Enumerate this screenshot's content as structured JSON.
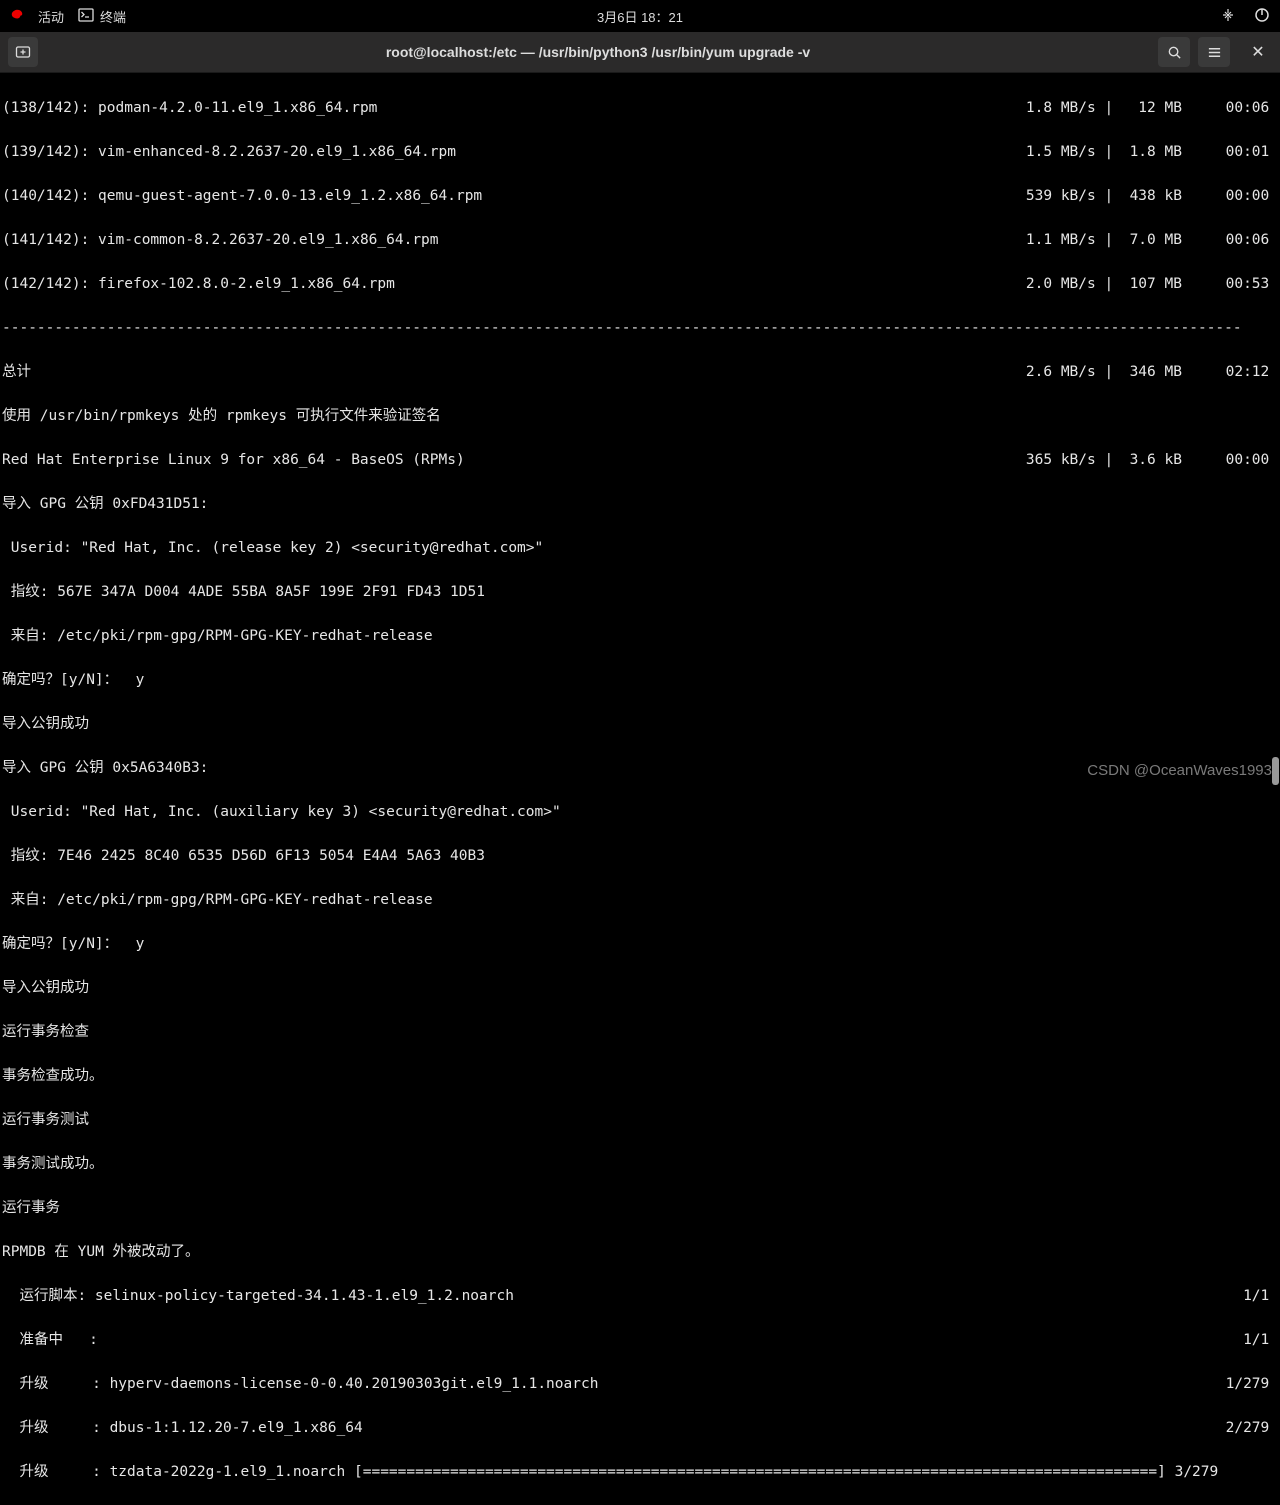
{
  "topbar": {
    "activities": "活动",
    "app": "终端",
    "clock": "3月6日 18：21"
  },
  "window": {
    "title": "root@localhost:/etc — /usr/bin/python3 /usr/bin/yum upgrade -v"
  },
  "downloads": [
    {
      "idx": "(138/142):",
      "name": "podman-4.2.0-11.el9_1.x86_64.rpm",
      "speed": "1.8 MB/s",
      "size": "12 MB",
      "time": "00:06"
    },
    {
      "idx": "(139/142):",
      "name": "vim-enhanced-8.2.2637-20.el9_1.x86_64.rpm",
      "speed": "1.5 MB/s",
      "size": "1.8 MB",
      "time": "00:01"
    },
    {
      "idx": "(140/142):",
      "name": "qemu-guest-agent-7.0.0-13.el9_1.2.x86_64.rpm",
      "speed": "539 kB/s",
      "size": "438 kB",
      "time": "00:00"
    },
    {
      "idx": "(141/142):",
      "name": "vim-common-8.2.2637-20.el9_1.x86_64.rpm",
      "speed": "1.1 MB/s",
      "size": "7.0 MB",
      "time": "00:06"
    },
    {
      "idx": "(142/142):",
      "name": "firefox-102.8.0-2.el9_1.x86_64.rpm",
      "speed": "2.0 MB/s",
      "size": "107 MB",
      "time": "00:53"
    }
  ],
  "total": {
    "label": "总计",
    "speed": "2.6 MB/s",
    "size": "346 MB",
    "time": "02:12"
  },
  "verify_line": "使用 /usr/bin/rpmkeys 处的 rpmkeys 可执行文件来验证签名",
  "repo": {
    "name": "Red Hat Enterprise Linux 9 for x86_64 - BaseOS (RPMs)",
    "speed": "365 kB/s",
    "size": "3.6 kB",
    "time": "00:00"
  },
  "gpg1": {
    "import": "导入 GPG 公钥 0xFD431D51:",
    "userid": " Userid: \"Red Hat, Inc. (release key 2) <security@redhat.com>\"",
    "fp": " 指纹: 567E 347A D004 4ADE 55BA 8A5F 199E 2F91 FD43 1D51",
    "from": " 来自: /etc/pki/rpm-gpg/RPM-GPG-KEY-redhat-release",
    "confirm": "确定吗？[y/N]：  y",
    "ok": "导入公钥成功"
  },
  "gpg2": {
    "import": "导入 GPG 公钥 0x5A6340B3:",
    "userid": " Userid: \"Red Hat, Inc. (auxiliary key 3) <security@redhat.com>\"",
    "fp": " 指纹: 7E46 2425 8C40 6535 D56D 6F13 5054 E4A4 5A63 40B3",
    "from": " 来自: /etc/pki/rpm-gpg/RPM-GPG-KEY-redhat-release",
    "confirm": "确定吗？[y/N]：  y",
    "ok": "导入公钥成功"
  },
  "tx": {
    "check_run": "运行事务检查",
    "check_ok": "事务检查成功。",
    "test_run": "运行事务测试",
    "test_ok": "事务测试成功。",
    "run": "运行事务",
    "rpmdb": "RPMDB 在 YUM 外被改动了。"
  },
  "steps": [
    {
      "left": "  运行脚本: selinux-policy-targeted-34.1.43-1.el9_1.2.noarch",
      "right": "1/1"
    },
    {
      "left": "  准备中   :",
      "right": "1/1"
    },
    {
      "left": "  升级     : hyperv-daemons-license-0-0.40.20190303git.el9_1.1.noarch",
      "right": "1/279"
    },
    {
      "left": "  升级     : dbus-1:1.12.20-7.el9_1.x86_64",
      "right": "2/279"
    }
  ],
  "progress": {
    "left": "  升级     : tzdata-2022g-1.el9_1.noarch [===========================================================================================] 3/279"
  },
  "watermark": "CSDN @OceanWaves1993"
}
